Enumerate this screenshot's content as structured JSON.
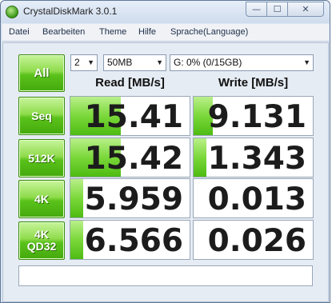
{
  "window": {
    "title": "CrystalDiskMark 3.0.1"
  },
  "controls": {
    "minimize": "—",
    "maximize": "☐",
    "close": "✕"
  },
  "menu": [
    "Datei",
    "Bearbeiten",
    "Theme",
    "Hilfe",
    "Sprache(Language)"
  ],
  "settings": {
    "all_label": "All",
    "runs": "2",
    "size": "50MB",
    "drive": "G: 0% (0/15GB)"
  },
  "headers": {
    "read": "Read [MB/s]",
    "write": "Write [MB/s]"
  },
  "tests": [
    {
      "label1": "Seq",
      "label2": "",
      "read": "15.41",
      "write": "9.131",
      "read_fill": 0.42,
      "write_fill": 0.16
    },
    {
      "label1": "512K",
      "label2": "",
      "read": "15.42",
      "write": "1.343",
      "read_fill": 0.42,
      "write_fill": 0.11
    },
    {
      "label1": "4K",
      "label2": "",
      "read": "5.959",
      "write": "0.013",
      "read_fill": 0.11,
      "write_fill": 0.0
    },
    {
      "label1": "4K",
      "label2": "QD32",
      "read": "6.566",
      "write": "0.026",
      "read_fill": 0.11,
      "write_fill": 0.0
    }
  ],
  "status": {
    "text": ""
  },
  "colors": {
    "accent_green": "#5ac21a",
    "window_bg": "#dde7f3"
  }
}
